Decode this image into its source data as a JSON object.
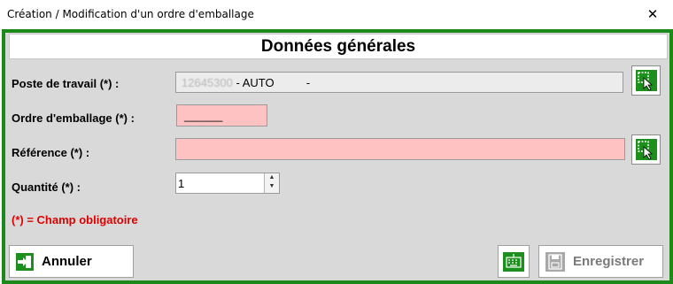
{
  "window": {
    "title": "Création / Modification d'un ordre d'emballage",
    "close_symbol": "✕"
  },
  "header": {
    "title": "Données générales"
  },
  "form": {
    "poste": {
      "label": "Poste de travail (*) :",
      "code": "12645300",
      "value": "- AUTO          -"
    },
    "ordre": {
      "label": "Ordre d'emballage (*) :",
      "value": "______"
    },
    "reference": {
      "label": "Référence (*) :",
      "value": ""
    },
    "quantite": {
      "label": "Quantité (*) :",
      "value": "1"
    },
    "required_note": "(*) = Champ obligatoire"
  },
  "footer": {
    "cancel_label": "Annuler",
    "save_label": "Enregistrer"
  },
  "colors": {
    "frame_green": "#1b8a1b",
    "required_pink": "#ffc2c2",
    "note_red": "#e00000",
    "disabled_text": "#7a7a7a"
  },
  "icons": {
    "picker": "pick-cursor-icon",
    "cancel": "exit-arrow-icon",
    "keyboard": "keyboard-icon",
    "save": "floppy-disk-icon",
    "close": "close-icon"
  }
}
